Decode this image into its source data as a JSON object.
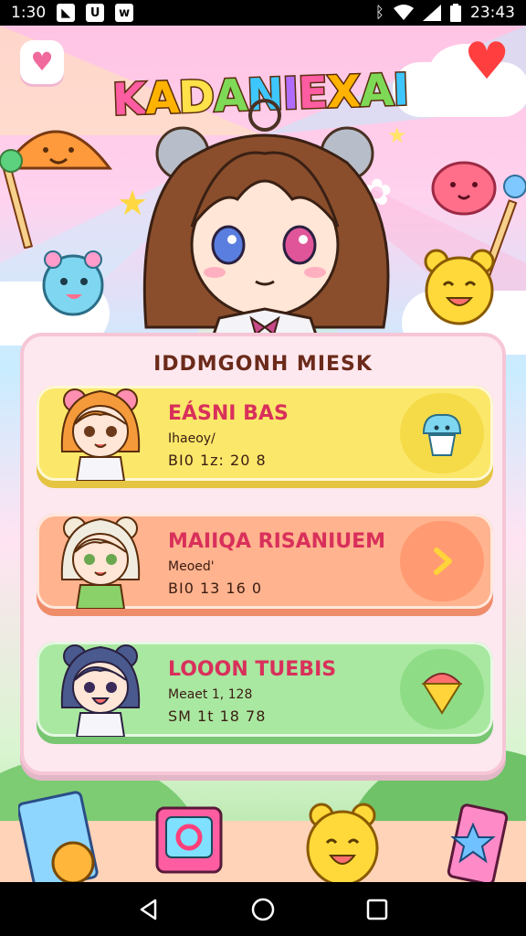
{
  "status_bar": {
    "time": "1:30",
    "clock_right": "23:43",
    "left_icons": [
      "notification-icon",
      "app-icon",
      "app-icon"
    ],
    "right_icons": [
      "bluetooth-icon",
      "wifi-icon",
      "signal-icon",
      "battery-icon"
    ]
  },
  "game": {
    "title": "KADANIEXAI",
    "title_colors": [
      "#ff5da2",
      "#ffb300",
      "#ffe14a",
      "#7ed957",
      "#3ec6ff",
      "#b06cff",
      "#ff5da2",
      "#ffb300",
      "#7ed957",
      "#3ec6ff"
    ],
    "menu": {
      "title": "IDDMGONH MIESK",
      "levels": [
        {
          "name": "EÁSNI BAS",
          "sub": "Ihaeoy/",
          "time": "BI0 1z: 20  8",
          "color": "#fbe76a",
          "shade": "#e5c441",
          "action": "cupcake-icon",
          "avatar_hair": "#f59a3a"
        },
        {
          "name": "MAIIQA RISANIUEM",
          "sub": "Meoed'",
          "time": "BI0 13 16  0",
          "color": "#ffb38e",
          "shade": "#ef8c6a",
          "action": "chevron-right-icon",
          "avatar_hair": "#f1ece0"
        },
        {
          "name": "LOOON TUEBIS",
          "sub": "Meaet 1, 128",
          "time": "SM 1t 18 78",
          "color": "#a9e8a1",
          "shade": "#78c672",
          "action": "ice-cream-icon",
          "avatar_hair": "#4a5a8e"
        }
      ]
    }
  },
  "nav": {
    "back": "back-icon",
    "home": "home-icon",
    "recents": "recents-icon"
  }
}
